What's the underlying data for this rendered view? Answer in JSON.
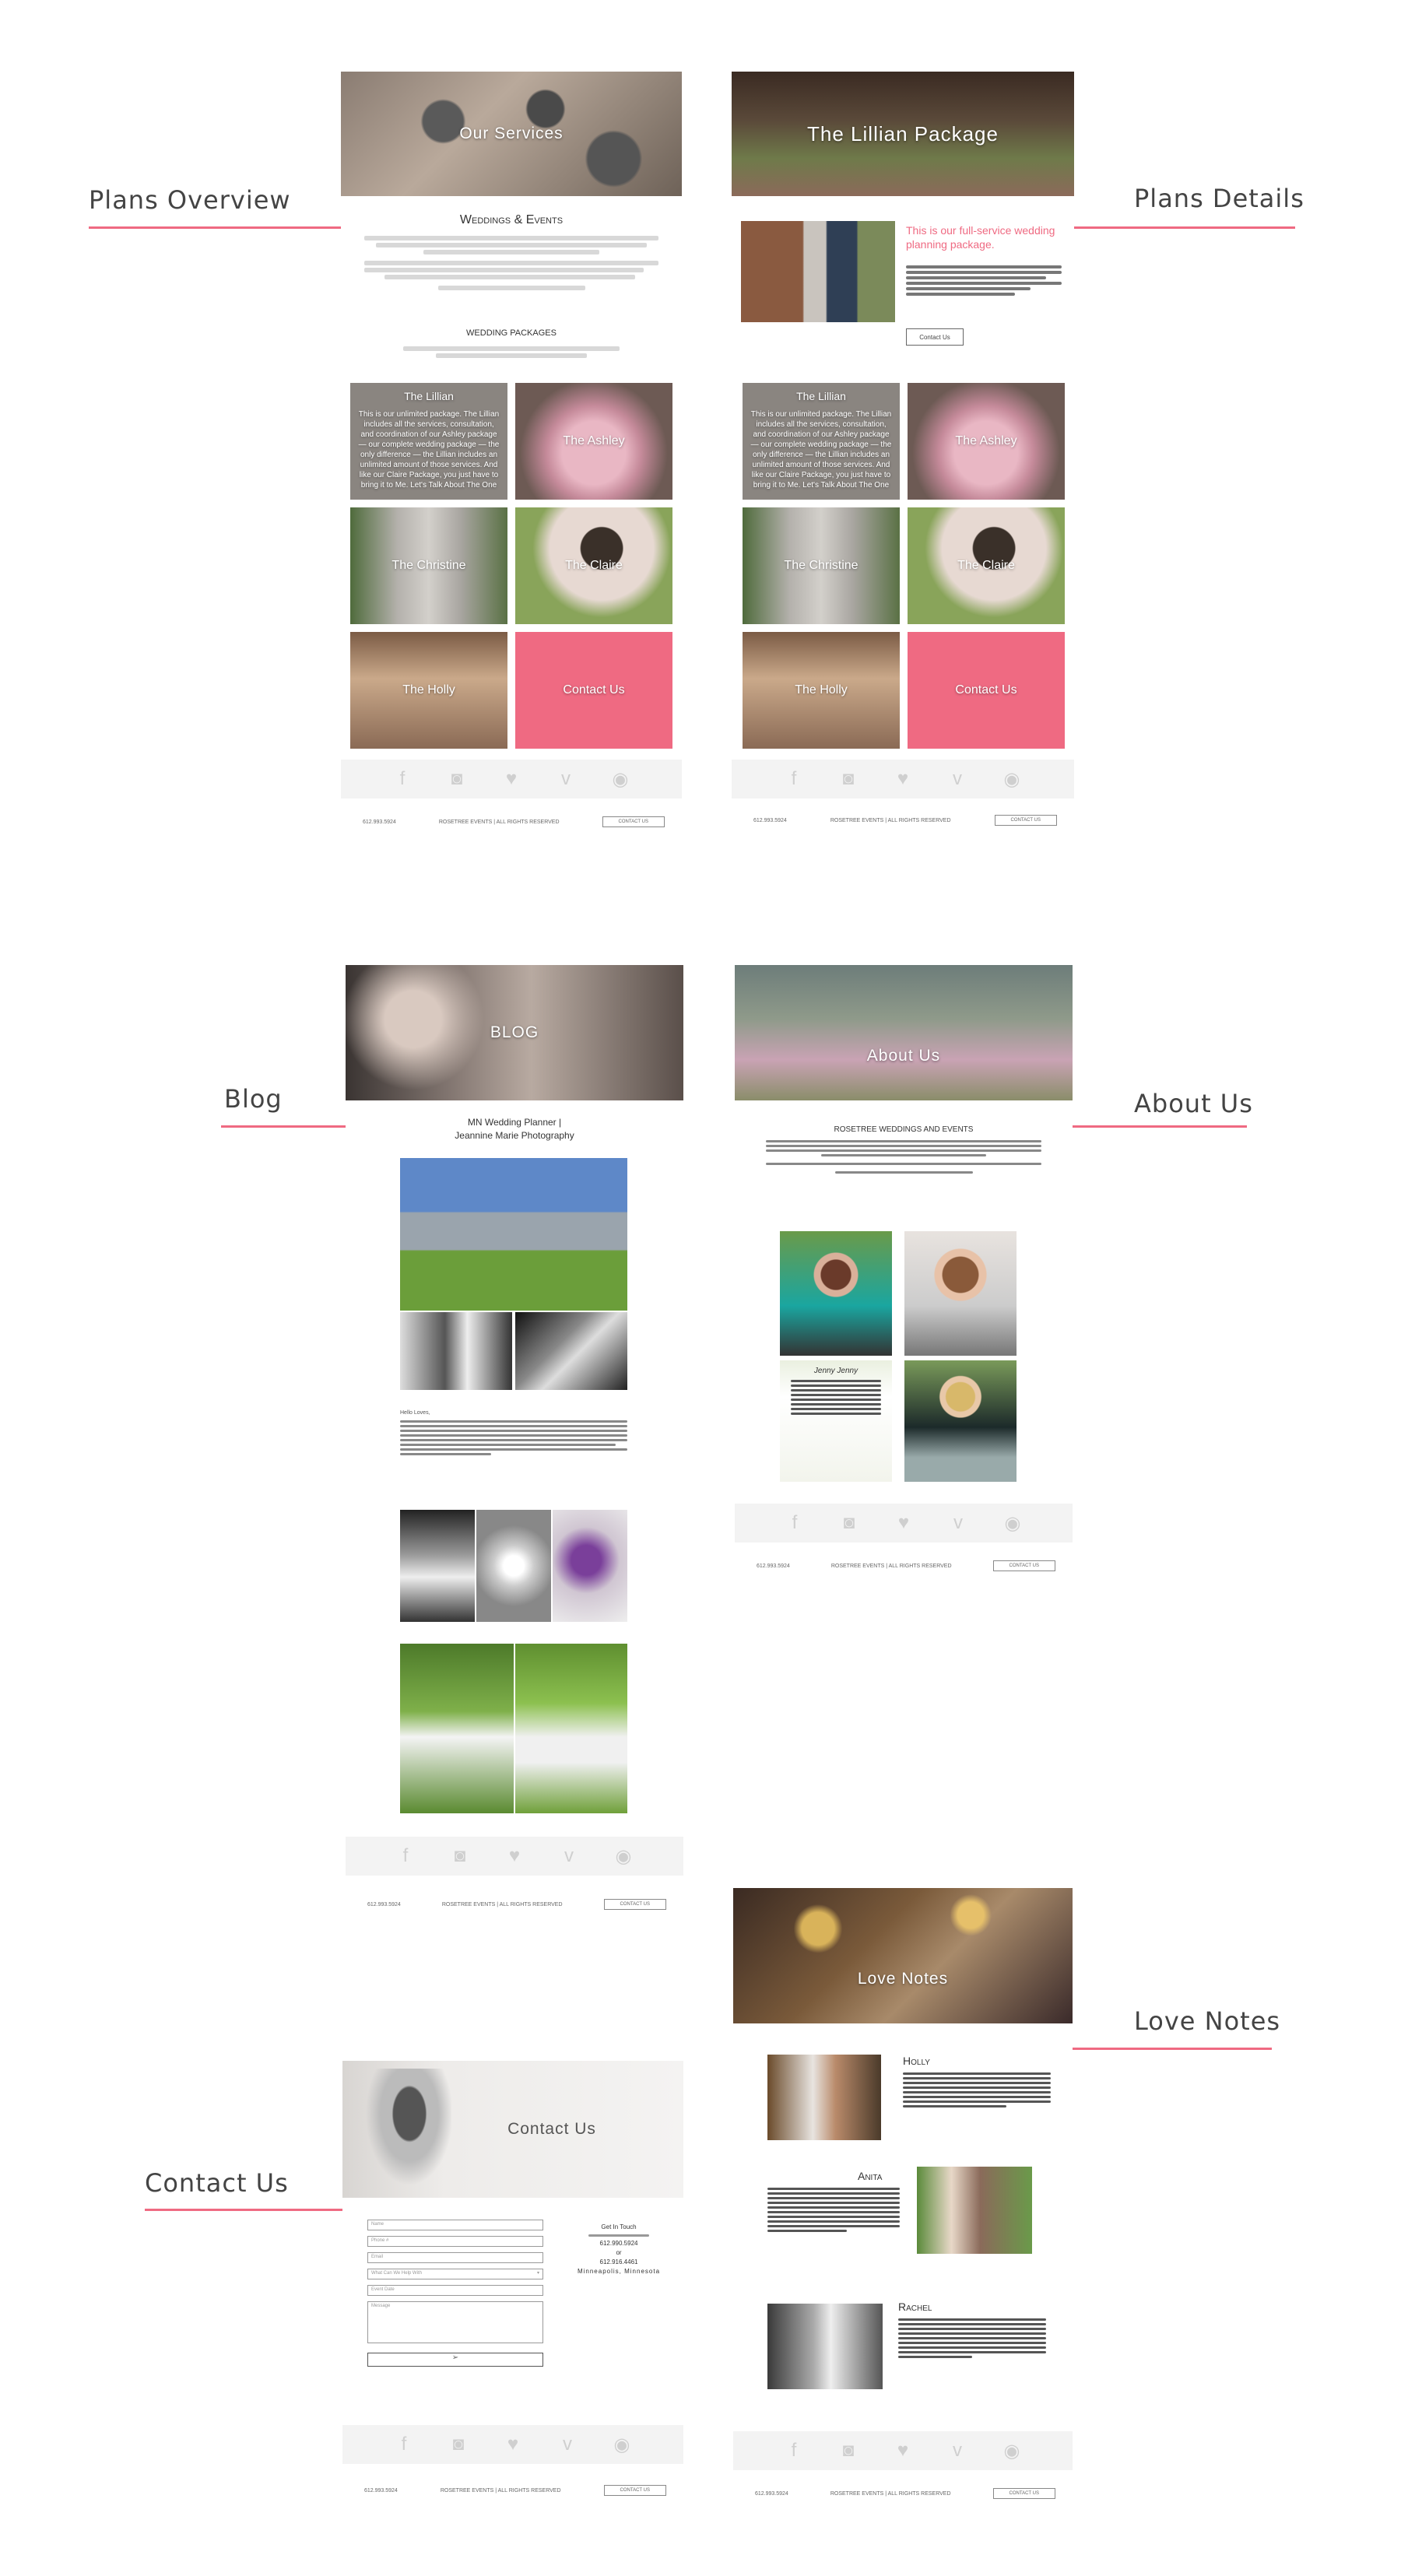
{
  "annotations": {
    "plans_overview": "Plans Overview",
    "plans_details": "Plans Details",
    "blog": "Blog",
    "about_us": "About Us",
    "love_notes": "Love Notes",
    "contact_us": "Contact Us"
  },
  "colors": {
    "accent": "#ef6a82",
    "social_bg": "#f3f3f3"
  },
  "shared": {
    "phone": "612.993.5924",
    "copyright": "ROSETREE EVENTS | ALL RIGHTS RESERVED",
    "contact_button": "CONTACT US",
    "social_icons": [
      "facebook-icon",
      "instagram-icon",
      "twitter-icon",
      "vimeo-icon",
      "spotify-icon"
    ]
  },
  "packages": {
    "lillian": "The Lillian",
    "ashley": "The Ashley",
    "christine": "The Christine",
    "claire": "The Claire",
    "holly": "The Holly",
    "contact": "Contact Us",
    "lillian_desc": "This is our unlimited package. The Lillian includes all the services, consultation, and coordination of our Ashley package — our complete wedding package — the only difference — the Lillian includes an unlimited amount of those services. And like our Claire Package, you just have to bring it to Me. Let's Talk About The One"
  },
  "overview": {
    "hero_title": "Our Services",
    "heading": "Weddings & Events",
    "subheading": "WEDDING PACKAGES"
  },
  "details": {
    "hero_title": "The Lillian Package",
    "pink_intro": "This is our full-service wedding planning package.",
    "button": "Contact Us"
  },
  "blog": {
    "hero_title": "BLOG",
    "post_title_1": "MN Wedding Planner |",
    "post_title_2": "Jeannine Marie Photography",
    "post_label": "Hello Loves,"
  },
  "about": {
    "hero_title": "About Us",
    "heading": "ROSETREE WEDDINGS AND EVENTS",
    "card_label": "Jenny Jenny"
  },
  "love": {
    "hero_title": "Love Notes",
    "names": [
      "Holly",
      "Anita",
      "Rachel"
    ]
  },
  "contact": {
    "hero_title": "Contact Us",
    "fields": [
      "Name",
      "Phone #",
      "Email",
      "What Can We Help With",
      "Event Date",
      "Message"
    ],
    "get_in_touch": "Get In Touch",
    "phone_1": "612.990.5924",
    "or": "or",
    "phone_2": "612.916.4461",
    "city": "Minneapolis, Minnesota"
  }
}
